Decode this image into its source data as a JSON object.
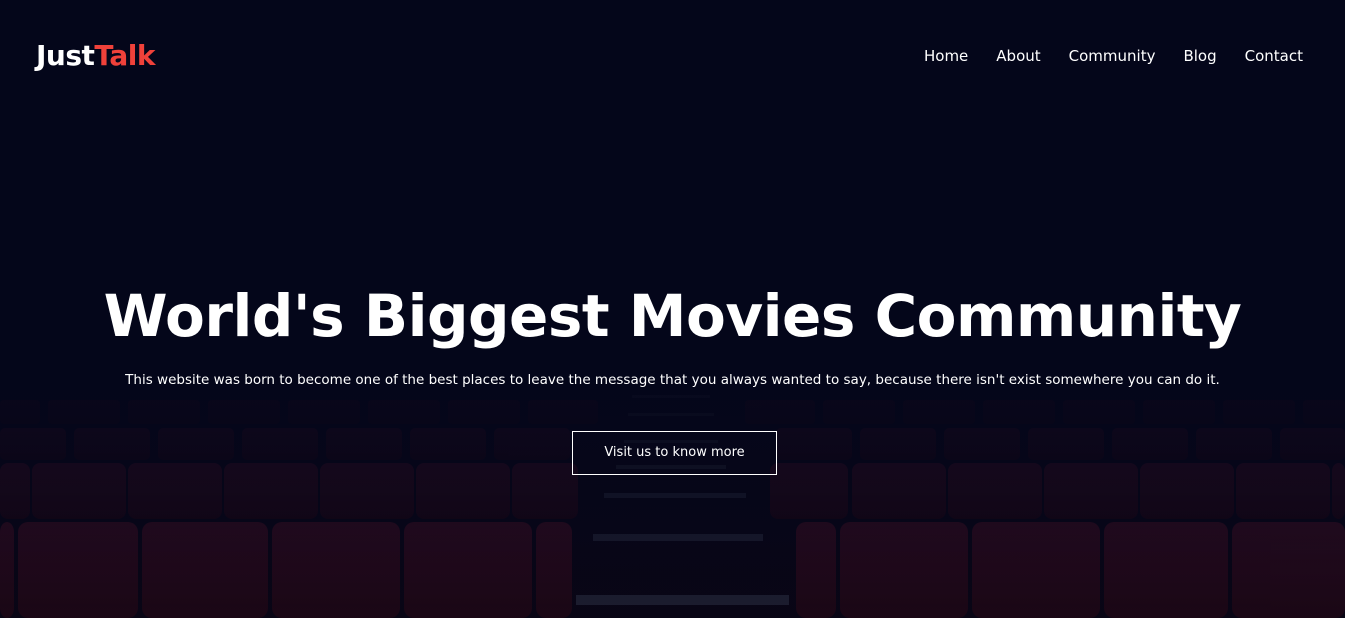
{
  "brand": {
    "name_part1": "Just",
    "name_part2": "Talk",
    "accent_color": "#f0413a"
  },
  "nav": {
    "items": [
      {
        "label": "Home"
      },
      {
        "label": "About"
      },
      {
        "label": "Community"
      },
      {
        "label": "Blog"
      },
      {
        "label": "Contact"
      }
    ]
  },
  "hero": {
    "headline": "World's Biggest Movies Community",
    "subtitle": "This website was born to become one of the best places to leave the message that you always wanted to say, because there isn't exist somewhere you can do it.",
    "cta_label": "Visit us to know more",
    "background_color": "#04061a",
    "seat_color": "#3a0b1a"
  }
}
